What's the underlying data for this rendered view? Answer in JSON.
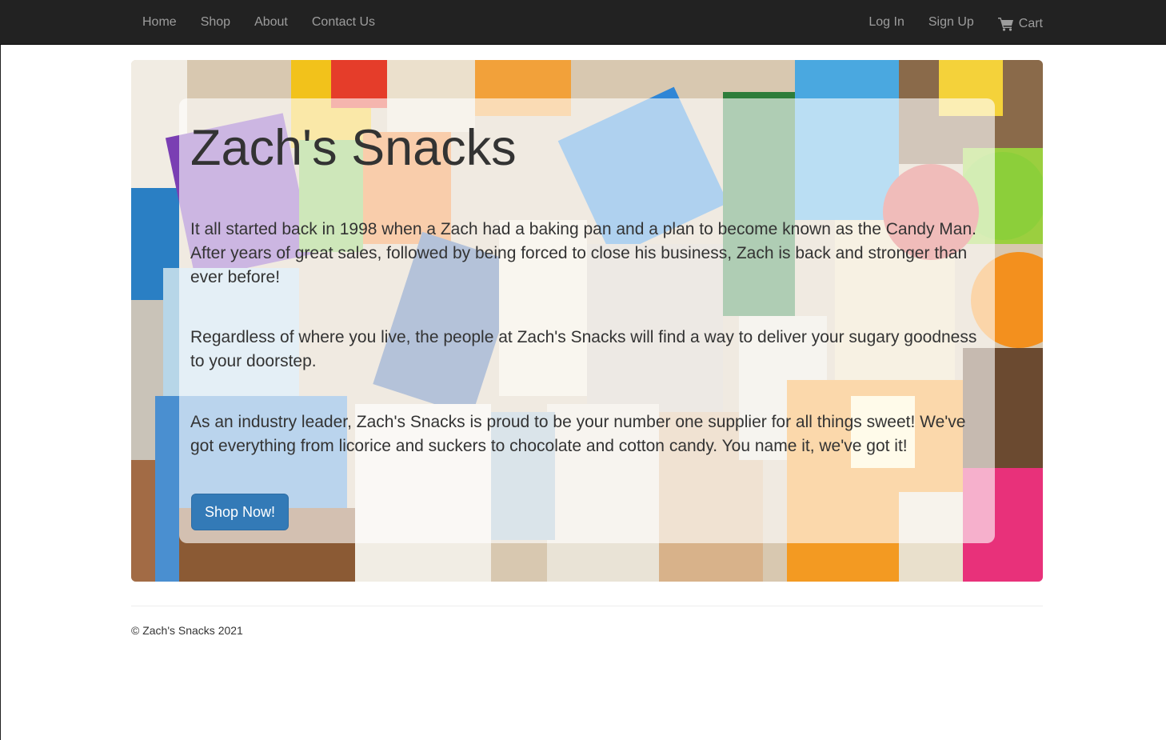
{
  "nav": {
    "home": "Home",
    "shop": "Shop",
    "about": "About",
    "contact": "Contact Us",
    "login": "Log In",
    "signup": "Sign Up",
    "cart": "Cart",
    "cart_icon": "shopping-cart-icon"
  },
  "hero": {
    "title": "Zach's Snacks",
    "paragraphs": [
      "It all started back in 1998 when a Zach had a baking pan and a plan to become known as the Candy Man. After years of great sales, followed by being forced to close his business, Zach is back and stronger than ever before!",
      "Regardless of where you live, the people at Zach's Snacks will find a way to deliver your sugary goodness to your doorstep.",
      "As an industry leader, Zach's Snacks is proud to be your number one supplier for all things sweet! We've got everything from licorice and suckers to chocolate and cotton candy. You name it, we've got it!"
    ],
    "button_label": "Shop Now!",
    "background": "assorted-snacks-photo"
  },
  "footer": {
    "copyright": "© Zach's Snacks 2021"
  },
  "colors": {
    "navbar_bg": "#222222",
    "nav_link": "#9d9d9d",
    "button_primary": "#337ab7",
    "text": "#333333"
  }
}
